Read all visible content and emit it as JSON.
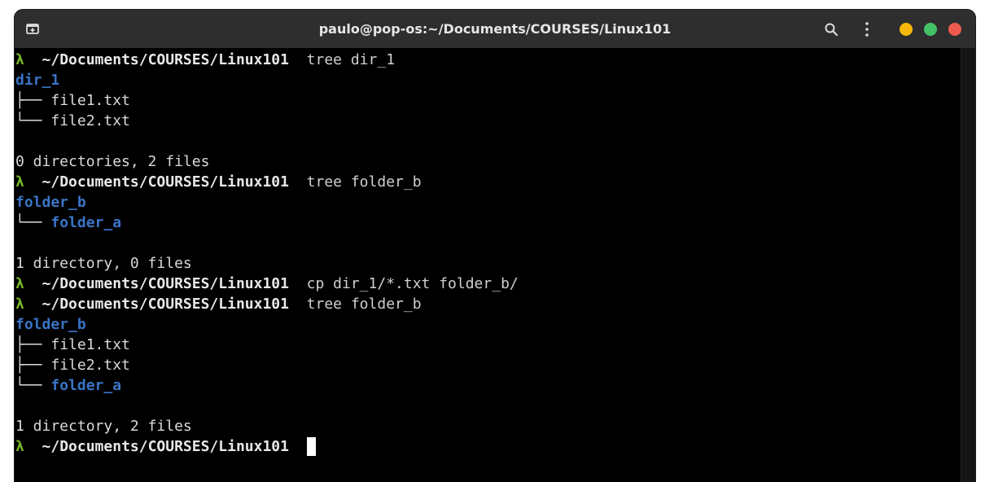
{
  "window": {
    "title": "paulo@pop-os:~/Documents/COURSES/Linux101",
    "icons": {
      "new_tab": "new-tab-icon",
      "search": "search-icon",
      "menu": "kebab-menu-icon"
    },
    "controls": {
      "minimize_color": "#f6b80a",
      "maximize_color": "#43c267",
      "close_color": "#ee5a50"
    }
  },
  "terminal": {
    "prompt_symbol": "λ",
    "prompt_path": "~/Documents/COURSES/Linux101",
    "lines": {
      "l1_cmd": "tree dir_1",
      "l2_dir": "dir_1",
      "l3_branch": "├── ",
      "l3_file": "file1.txt",
      "l4_branch": "└── ",
      "l4_file": "file2.txt",
      "l6_summary": "0 directories, 2 files",
      "l7_cmd": "tree folder_b",
      "l8_dir": "folder_b",
      "l9_branch": "└── ",
      "l9_dir": "folder_a",
      "l11_summary": "1 directory, 0 files",
      "l12_cmd": "cp dir_1/*.txt folder_b/",
      "l13_cmd": "tree folder_b",
      "l14_dir": "folder_b",
      "l15_branch": "├── ",
      "l15_file": "file1.txt",
      "l16_branch": "├── ",
      "l16_file": "file2.txt",
      "l17_branch": "└── ",
      "l17_dir": "folder_a",
      "l19_summary": "1 directory, 2 files"
    }
  }
}
